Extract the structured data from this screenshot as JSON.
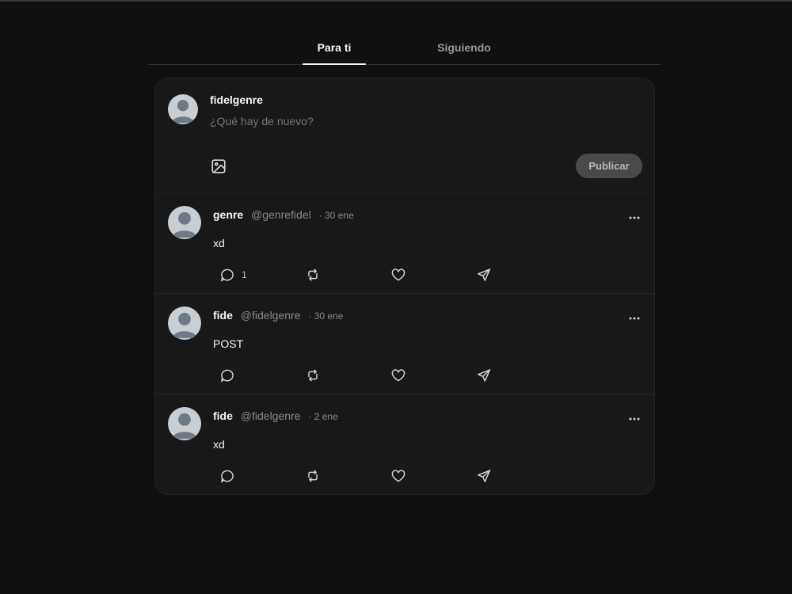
{
  "tabs": [
    {
      "label": "Para ti",
      "active": true
    },
    {
      "label": "Siguiendo",
      "active": false
    }
  ],
  "composer": {
    "username": "fidelgenre",
    "placeholder": "¿Qué hay de nuevo?",
    "image_icon": "image-icon",
    "publish_label": "Publicar"
  },
  "posts": [
    {
      "name": "genre",
      "handle": "@genrefidel",
      "date": "· 30 ene",
      "text": "xd",
      "reply_count": "1"
    },
    {
      "name": "fide",
      "handle": "@fidelgenre",
      "date": "· 30 ene",
      "text": "POST",
      "reply_count": ""
    },
    {
      "name": "fide",
      "handle": "@fidelgenre",
      "date": "· 2 ene",
      "text": "xd",
      "reply_count": ""
    }
  ],
  "icons": {
    "reply": "chat-bubble-icon",
    "repost": "repost-icon",
    "like": "heart-icon",
    "share": "send-icon",
    "more": "more-horizontal-icon"
  },
  "colors": {
    "background": "#101010",
    "card": "#181818",
    "text": "#f3f5f7",
    "muted": "#8a8a8a",
    "publish_button": "#4a4a4a"
  }
}
